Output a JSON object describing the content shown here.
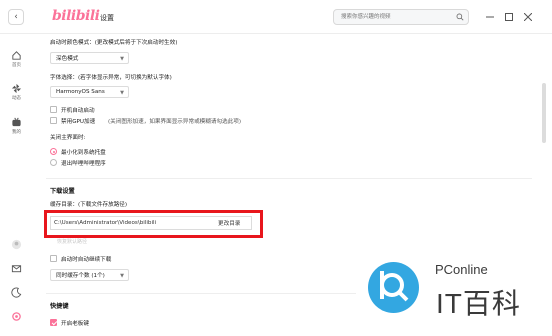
{
  "app": {
    "logo_text": "bilibili",
    "page_title": "设置"
  },
  "search": {
    "placeholder": "搜索你感兴趣的视频"
  },
  "sidebar": {
    "items": [
      {
        "label": "首页",
        "icon": "home-icon"
      },
      {
        "label": "动态",
        "icon": "pinwheel-icon"
      },
      {
        "label": "我的",
        "icon": "tv-icon"
      }
    ],
    "bottom_icons": [
      "avatar-icon",
      "mail-icon",
      "theme-icon",
      "settings-icon"
    ]
  },
  "settings": {
    "startup_color_label": "启动时颜色模式：(更改模式后将于下次启动时生效)",
    "startup_color_value": "深色模式",
    "font_label": "字体选择：(若字体显示异常，可切换为默认字体)",
    "font_value": "HarmonyOS Sans",
    "autostart_label": "开机自动启动",
    "autostart_checked": false,
    "gpu_label": "禁用GPU加速",
    "gpu_note": "(关闭图形加速，如果界面显示异常或模糊请勾选此项)",
    "gpu_checked": false,
    "close_label": "关闭主界面时:",
    "close_options": [
      {
        "label": "最小化到系统托盘",
        "checked": true
      },
      {
        "label": "退出哔哩哔哩程序",
        "checked": false
      }
    ]
  },
  "download": {
    "section_title": "下载设置",
    "cache_label": "缓存目录：(下载文件存放路径)",
    "cache_path": "C:\\Users\\Administrator\\Videos\\bilibili",
    "change_dir_label": "更改目录",
    "restore_default_label": "恢复默认路径",
    "auto_continue_label": "启动时自动继续下载",
    "auto_continue_checked": false,
    "concurrent_value": "同时缓存个数 (1个)"
  },
  "shortcuts": {
    "section_title": "快捷键",
    "boss_key_label": "开启老板键",
    "boss_key_checked": true
  },
  "watermark": {
    "en": "PConline",
    "cn": "IT百科"
  },
  "colors": {
    "accent": "#fb7299",
    "highlight": "#e8161c",
    "watermark_blue": "#33a7e1"
  }
}
